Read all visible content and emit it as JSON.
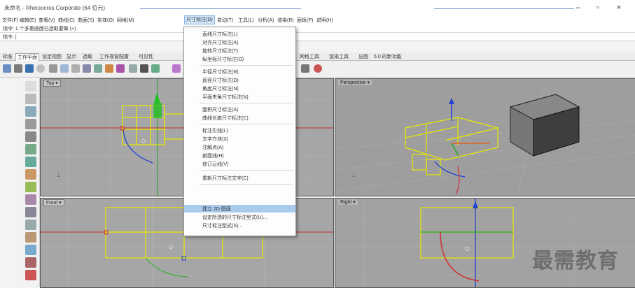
{
  "window": {
    "title": "未命名 - Rhinoceros Corporate (64 位元)",
    "minimize": "–",
    "maximize": "▫",
    "close": "×"
  },
  "menubar": {
    "items": [
      {
        "label": "文件(F)"
      },
      {
        "label": "编辑(E)"
      },
      {
        "label": "查看(V)"
      },
      {
        "label": "曲线(C)"
      },
      {
        "label": "曲面(S)"
      },
      {
        "label": "实体(O)"
      },
      {
        "label": "网格(M)"
      },
      {
        "label": "尺寸标注(D)"
      },
      {
        "label": "变动(T)"
      },
      {
        "label": "工具(L)"
      },
      {
        "label": "分析(A)"
      },
      {
        "label": "渲染(R)"
      },
      {
        "label": "面板(P)"
      },
      {
        "label": "说明(H)"
      }
    ]
  },
  "command": {
    "history": "指令: 1 个多重曲面已选取要做 (+)",
    "prompt": "指令: |"
  },
  "tabs": [
    {
      "label": "标准"
    },
    {
      "label": "工作平面"
    },
    {
      "label": "设定视图"
    },
    {
      "label": "显示"
    },
    {
      "label": "选取"
    },
    {
      "label": "工作视窗配置"
    },
    {
      "label": "可见性"
    },
    {
      "label": "网格工具"
    },
    {
      "label": "渲染工具"
    },
    {
      "label": "出图"
    },
    {
      "label": "5.0 的新功能"
    }
  ],
  "viewports": {
    "top": {
      "label": "Top ▾"
    },
    "perspective": {
      "label": "Perspective ▾"
    },
    "front": {
      "label": "Front ▾"
    },
    "right": {
      "label": "Right ▾"
    }
  },
  "dropdown": {
    "groups": [
      [
        "直线尺寸标注(L)",
        "对齐尺寸标注(A)",
        "旋转尺寸标注(T)",
        "纵坐标尺寸标注(O)"
      ],
      [
        "半径尺寸标注(R)",
        "直径尺寸标注(D)",
        "角度尺寸标注(N)",
        "平面夹角尺寸标注(N)"
      ],
      [
        "面积尺寸标注(A)",
        "曲线长度尺寸标注(C)"
      ],
      [
        "标注引线(L)",
        "文字方块(X)",
        "注解点(A)",
        "剖面线(H)",
        "修订云线(V)"
      ],
      [
        "重新尺寸标注文字(C)"
      ],
      [
        "建立 2D 图面",
        "设定所选的尺寸标注型式(U)...",
        "尺寸标注型式(S)..."
      ]
    ],
    "highlighted": "建立 2D 图面"
  },
  "watermark": "最需教育",
  "colors": {
    "viewport_bg": "#a6a6a6",
    "object_yellow": "#e8e800",
    "axis_red": "#d03030",
    "axis_green": "#20b020",
    "axis_blue": "#2040d0",
    "menu_highlight": "#a9cbee"
  }
}
